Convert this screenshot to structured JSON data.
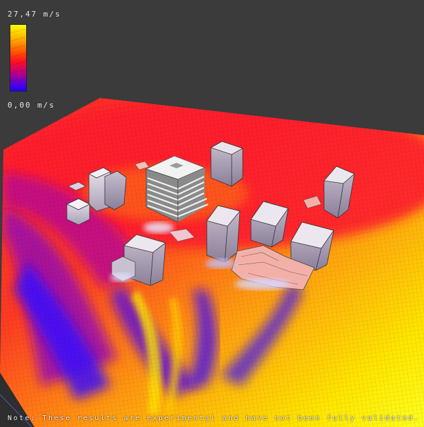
{
  "legend": {
    "max_label": "27,47 m/s",
    "min_label": "0,00 m/s",
    "max_value": 27.47,
    "min_value": 0.0,
    "unit": "m/s",
    "colors": [
      "#ffff00",
      "#ffb300",
      "#ff6a00",
      "#ff1a1a",
      "#c8006e",
      "#7a00c8",
      "#2a00ff"
    ]
  },
  "footer": {
    "note": "Note: These results are experimental and have not been fully validated."
  }
}
